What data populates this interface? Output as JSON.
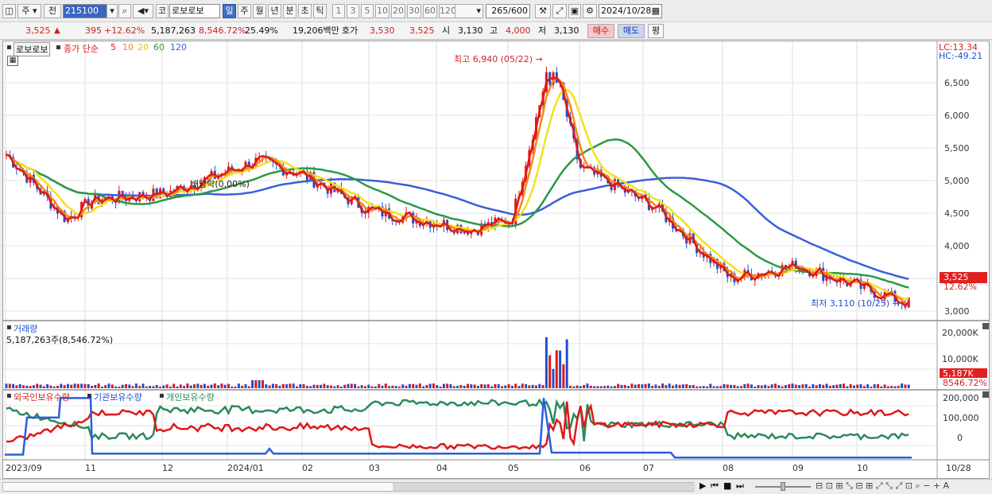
{
  "toolbar": {
    "market_sel": "주",
    "prev_label": "전",
    "code": "215100",
    "code_type": "코",
    "stock_name": "로보로보",
    "periods": [
      "일",
      "주",
      "월",
      "년",
      "분",
      "초",
      "틱"
    ],
    "active_period": "일",
    "intervals": [
      "1",
      "3",
      "5",
      "10",
      "20",
      "30",
      "60",
      "120"
    ],
    "count": "265",
    "count_max": "/600",
    "date": "2024/10/28"
  },
  "quote": {
    "price": "3,525",
    "change_arrow": "▲",
    "change": "395",
    "change_pct": "+12.62%",
    "volume": "5,187,263",
    "volume_pct": "8,546.72%",
    "turnover": "25.49%",
    "amount": "19,206백만",
    "bid_label": "호가",
    "bid": "3,530",
    "ask": "3,525",
    "open_label": "시",
    "open": "3,130",
    "high_label": "고",
    "high": "4,000",
    "low_label": "저",
    "low": "3,130",
    "buy_label": "매수",
    "sell_label": "매도",
    "avg_label": "평"
  },
  "price_panel": {
    "name_tag": "로보로보",
    "ma_label": "종가 단순",
    "ma_periods": [
      "5",
      "10",
      "20",
      "60",
      "120"
    ],
    "ma_colors": [
      "#e01818",
      "#f08a1c",
      "#f2e21c",
      "#2a9a44",
      "#3a5fd8"
    ],
    "lc": "LC:13.34",
    "hc": "HC:-49.21",
    "y_ticks": [
      "6,500",
      "6,000",
      "5,500",
      "5,000",
      "4,500",
      "4,000",
      "3,500",
      "3,000"
    ],
    "high_note": "최고 6,940 (05/22)",
    "low_note": "최저 3,110 (10/25)",
    "dividend_note": "배당락(0.00%)",
    "last_price": "3,525",
    "last_pct": "12.62%"
  },
  "volume_panel": {
    "title": "거래량",
    "value": "5,187,263주(8,546.72%)",
    "y_ticks": [
      "20,000K",
      "10,000K"
    ],
    "last": "5,187K",
    "last_pct": "8546.72%"
  },
  "holding_panel": {
    "series": [
      "외국인보유수량",
      "기관보유수량",
      "개인보유수량"
    ],
    "series_colors": [
      "#e01818",
      "#2a5fd8",
      "#2a8a5a"
    ],
    "y_ticks": [
      "200,000",
      "100,000",
      "0"
    ]
  },
  "x_axis": [
    "2023/09",
    "11",
    "12",
    "2024/01",
    "02",
    "03",
    "04",
    "05",
    "06",
    "07",
    "08",
    "09",
    "10",
    "10/28"
  ],
  "chart_data": {
    "type": "candlestick",
    "title": "",
    "ylim": [
      2900,
      7100
    ],
    "ylabel": "",
    "months": [
      "2023/09",
      "11",
      "12",
      "2024/01",
      "02",
      "03",
      "04",
      "05",
      "06",
      "07",
      "08",
      "09",
      "10"
    ],
    "approx_close_path": [
      [
        "2023/09",
        5400
      ],
      [
        "2023/10",
        4400
      ],
      [
        "2023/11",
        4700
      ],
      [
        "2023/12",
        4800
      ],
      [
        "2024/01",
        5300
      ],
      [
        "2024/02",
        5100
      ],
      [
        "2024/03",
        4550
      ],
      [
        "2024/04",
        4250
      ],
      [
        "2024/05",
        4400
      ],
      [
        "2024/05/22",
        6940
      ],
      [
        "2024/06",
        5200
      ],
      [
        "2024/07",
        4600
      ],
      [
        "2024/08",
        3500
      ],
      [
        "2024/09",
        3700
      ],
      [
        "2024/10/25",
        3110
      ],
      [
        "2024/10/28",
        3525
      ]
    ],
    "annotations": {
      "high": 6940,
      "high_date": "05/22",
      "low": 3110,
      "low_date": "10/25"
    }
  }
}
